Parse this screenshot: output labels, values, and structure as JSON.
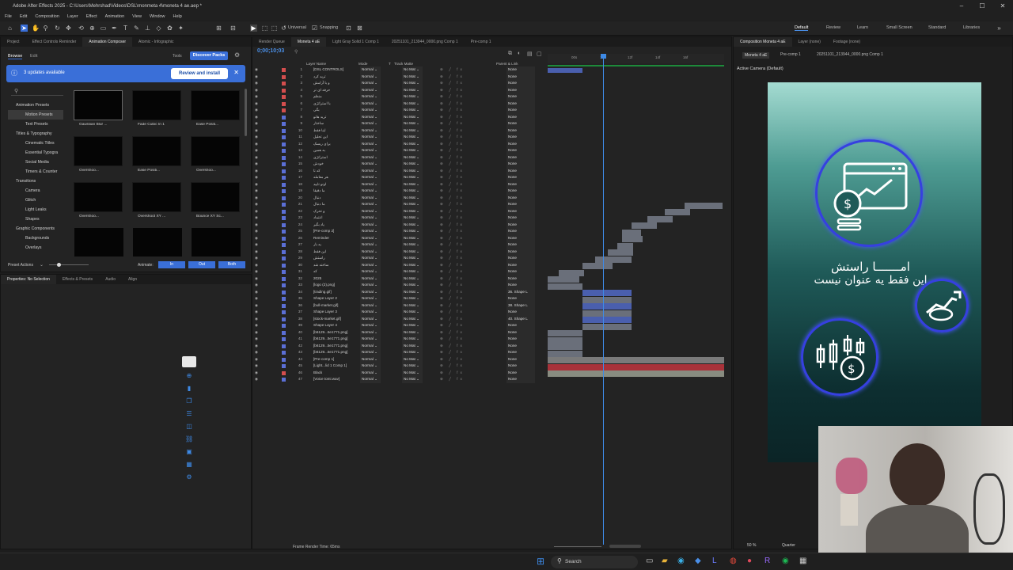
{
  "window": {
    "title": "Adobe After Effects 2025 - C:\\Users\\Mehrshad\\Videos\\DSL\\monmeta 4\\moneta 4 ae.aep *",
    "controls": [
      "–",
      "☐",
      "✕"
    ]
  },
  "menu": [
    "File",
    "Edit",
    "Composition",
    "Layer",
    "Effect",
    "Animation",
    "View",
    "Window",
    "Help"
  ],
  "toolbar": {
    "universal": "Universal",
    "snapping": "Snapping",
    "workspaces": [
      "Default",
      "Review",
      "Learn",
      "Small Screen",
      "Standard",
      "Libraries"
    ],
    "active_workspace": "Default"
  },
  "left_panel": {
    "tabs": [
      "Project",
      "Effect Controls Reminder",
      "Animation Composer",
      "Atomic - Infographic"
    ],
    "subtabs": [
      "Browse",
      "Edit"
    ],
    "tools_label": "Tools",
    "discover_button": "Discover Packs",
    "banner": {
      "text": "3 updates available",
      "button": "Review and install"
    },
    "tree": [
      "Animation Presets",
      "Motion Presets",
      "Text Presets",
      "Titles & Typography",
      "Cinematic Titles",
      "Essential Typogra",
      "Social Media",
      "Timers & Counter",
      "Transitions",
      "Camera",
      "Glitch",
      "Light Leaks",
      "Shapes",
      "Graphic Components",
      "Backgrounds",
      "Overlays"
    ],
    "thumbnails": [
      "Gaussian Blur ...",
      "Fade Cubic In 1",
      "Ease Positi...",
      "Overshoo...",
      "Ease Positi...",
      "Overshoo...",
      "Overshoo...",
      "Overshoot XY ...",
      "Bounce XY Sc..."
    ],
    "preset_actions": "Preset Actions",
    "animate_label": "Animate:",
    "animate_buttons": [
      "In",
      "Out",
      "Both"
    ],
    "bottom_tabs": [
      "Properties: No Selection",
      "Effects & Presets",
      "Audio",
      "Align"
    ]
  },
  "timeline_panel": {
    "tabs": [
      "Render Queue",
      "Moneta 4 aE",
      "Light Gray Solid 1 Comp 1",
      "20251101_213944_0000.png Comp 1",
      "Pre-comp 1"
    ],
    "timecode": "0;00;10;03",
    "columns": [
      "Layer Name",
      "Mode",
      "T",
      "Track Matte",
      "Parent & Link"
    ],
    "ruler": [
      "00s",
      "10f",
      "12f",
      "14f",
      "16f"
    ],
    "footer": "Frame Render Time: 65ms",
    "layers": [
      {
        "n": "1",
        "name": "[DSL CONTROLS]",
        "color": "#d44e4e",
        "parent": "None"
      },
      {
        "n": "2",
        "name": "ترید کرد",
        "color": "#d44e4e",
        "parent": "None"
      },
      {
        "n": "3",
        "name": "و با آرامش",
        "color": "#d44e4e",
        "parent": "None"
      },
      {
        "n": "4",
        "name": "حرفه ای تر",
        "color": "#d44e4e",
        "parent": "None"
      },
      {
        "n": "5",
        "name": "منظم",
        "color": "#d44e4e",
        "parent": "None"
      },
      {
        "n": "6",
        "name": "با استراتژی",
        "color": "#d44e4e",
        "parent": "None"
      },
      {
        "n": "7",
        "name": "بگی",
        "color": "#d44e4e",
        "parent": "None"
      },
      {
        "n": "8",
        "name": "ترید هاتو",
        "color": "#5b6fd6",
        "parent": "None"
      },
      {
        "n": "9",
        "name": "ساختار",
        "color": "#5b6fd6",
        "parent": "None"
      },
      {
        "n": "10",
        "name": "اینا فقط",
        "color": "#5b6fd6",
        "parent": "None"
      },
      {
        "n": "11",
        "name": "این تحلیل",
        "color": "#5b6fd6",
        "parent": "None"
      },
      {
        "n": "12",
        "name": "برای ریسک",
        "color": "#5b6fd6",
        "parent": "None"
      },
      {
        "n": "13",
        "name": "به همین",
        "color": "#5b6fd6",
        "parent": "None"
      },
      {
        "n": "14",
        "name": "استراتژی",
        "color": "#5b6fd6",
        "parent": "None"
      },
      {
        "n": "15",
        "name": "خودش",
        "color": "#5b6fd6",
        "parent": "None"
      },
      {
        "n": "16",
        "name": "که تا",
        "color": "#5b6fd6",
        "parent": "None"
      },
      {
        "n": "17",
        "name": "هر معامله",
        "color": "#5b6fd6",
        "parent": "None"
      },
      {
        "n": "18",
        "name": "اونو تایید",
        "color": "#5b6fd6",
        "parent": "None"
      },
      {
        "n": "19",
        "name": "ما دقیقا",
        "color": "#5b6fd6",
        "parent": "None"
      },
      {
        "n": "20",
        "name": "دنبال",
        "color": "#5b6fd6",
        "parent": "None"
      },
      {
        "n": "21",
        "name": "ما دنبال",
        "color": "#5b6fd6",
        "parent": "None"
      },
      {
        "n": "22",
        "name": "و تحرک",
        "color": "#5b6fd6",
        "parent": "None"
      },
      {
        "n": "23",
        "name": "اعتماد",
        "color": "#5b6fd6",
        "parent": "None"
      },
      {
        "n": "24",
        "name": "یاد بگیر",
        "color": "#5b6fd6",
        "parent": "None"
      },
      {
        "n": "25",
        "name": "[Pre-comp 2]",
        "color": "#5b6fd6",
        "parent": "None"
      },
      {
        "n": "26",
        "name": "Reminder",
        "color": "#5b6fd6",
        "parent": "None"
      },
      {
        "n": "27",
        "name": "یه بار",
        "color": "#5b6fd6",
        "parent": "None"
      },
      {
        "n": "28",
        "name": "این فقط",
        "color": "#5b6fd6",
        "parent": "None"
      },
      {
        "n": "29",
        "name": "راستش",
        "color": "#5b6fd6",
        "parent": "None"
      },
      {
        "n": "30",
        "name": "ساخته شد",
        "color": "#5b6fd6",
        "parent": "None"
      },
      {
        "n": "31",
        "name": "که",
        "color": "#5b6fd6",
        "parent": "None"
      },
      {
        "n": "32",
        "name": "2025",
        "color": "#5b6fd6",
        "parent": "None"
      },
      {
        "n": "33",
        "name": "[logo (2).png]",
        "color": "#5b6fd6",
        "parent": "None"
      },
      {
        "n": "34",
        "name": "[trading.gif]",
        "color": "#5b6fd6",
        "parent": "36. Shape L"
      },
      {
        "n": "35",
        "name": "Shape Layer 2",
        "color": "#5b6fd6",
        "parent": "None"
      },
      {
        "n": "36",
        "name": "[bull-market.gif]",
        "color": "#5b6fd6",
        "parent": "38. Shape L"
      },
      {
        "n": "37",
        "name": "Shape Layer 3",
        "color": "#5b6fd6",
        "parent": "None"
      },
      {
        "n": "38",
        "name": "[stock-market.gif]",
        "color": "#5b6fd6",
        "parent": "40. Shape L"
      },
      {
        "n": "39",
        "name": "Shape Layer 4",
        "color": "#5b6fd6",
        "parent": "None"
      },
      {
        "n": "40",
        "name": "[b6129...5e1771.png]",
        "color": "#5b6fd6",
        "parent": "None"
      },
      {
        "n": "41",
        "name": "[b6129...5e1771.png]",
        "color": "#5b6fd6",
        "parent": "None"
      },
      {
        "n": "42",
        "name": "[b6129...5e1771.png]",
        "color": "#5b6fd6",
        "parent": "None"
      },
      {
        "n": "43",
        "name": "[b6129...5e1771.png]",
        "color": "#5b6fd6",
        "parent": "None"
      },
      {
        "n": "44",
        "name": "[Pre-comp 1]",
        "color": "#5b6fd6",
        "parent": "None"
      },
      {
        "n": "45",
        "name": "[Light...lid 1 Comp 1]",
        "color": "#5b6fd6",
        "parent": "None"
      },
      {
        "n": "46",
        "name": "Black",
        "color": "#d44e4e",
        "parent": "None"
      },
      {
        "n": "47",
        "name": "[Voice tomi.wav]",
        "color": "#5b6fd6",
        "parent": "None"
      }
    ]
  },
  "comp_viewer": {
    "tabs": [
      "Composition Moneta 4 aE",
      "Layer (none)",
      "Footage (none)"
    ],
    "breadcrumb": [
      "Moneta 4 aE",
      "Pre-comp 1",
      "20251101_213944_0000.png Comp 1"
    ],
    "camera": "Active Camera (Default)",
    "text_line1": "امـــــــا راستش",
    "text_line2": "این فقط یه عنوان نیست",
    "zoom": "50 %",
    "quality": "Quarter"
  },
  "taskbar": {
    "search": "Search"
  },
  "colors": {
    "accent": "#3a6fd8",
    "ring": "#3640e0",
    "viewer_bg_top": "#9fd6cc",
    "viewer_bg_bottom": "#0b2a2c"
  }
}
